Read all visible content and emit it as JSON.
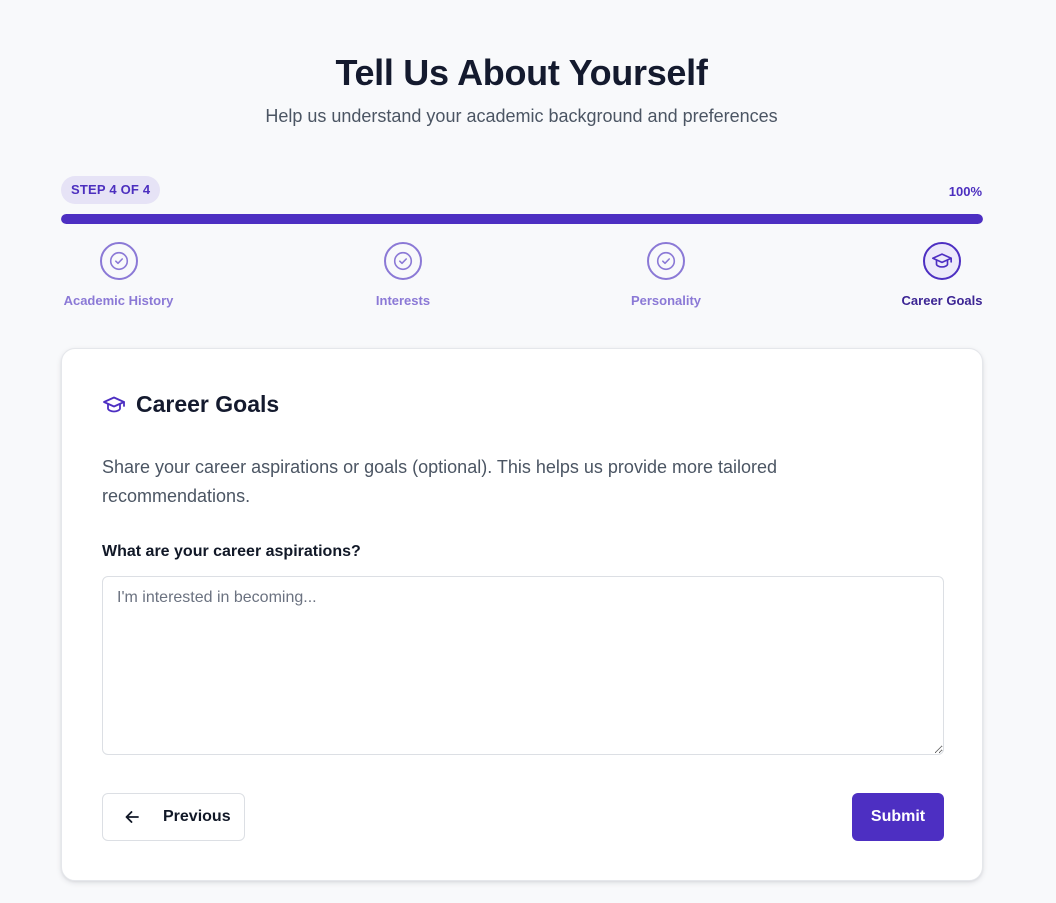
{
  "header": {
    "title": "Tell Us About Yourself",
    "subtitle": "Help us understand your academic background and preferences"
  },
  "progress": {
    "step_label": "STEP 4 OF 4",
    "percent_label": "100%",
    "percent": 100
  },
  "stepper": [
    {
      "label": "Academic History",
      "icon": "check-circle-icon",
      "state": "completed"
    },
    {
      "label": "Interests",
      "icon": "check-circle-icon",
      "state": "completed"
    },
    {
      "label": "Personality",
      "icon": "check-circle-icon",
      "state": "completed"
    },
    {
      "label": "Career Goals",
      "icon": "graduation-cap-icon",
      "state": "active"
    }
  ],
  "card": {
    "icon": "graduation-cap-icon",
    "title": "Career Goals",
    "description": "Share your career aspirations or goals (optional). This helps us provide more tailored recommendations.",
    "field_label": "What are your career aspirations?",
    "field_value": "",
    "field_placeholder": "I'm interested in becoming...",
    "previous_label": "Previous",
    "submit_label": "Submit"
  },
  "colors": {
    "accent": "#4d2fc2",
    "accent_light": "#8b79d6",
    "badge_bg": "#e6e3f6",
    "page_bg": "#f8f9fb"
  }
}
